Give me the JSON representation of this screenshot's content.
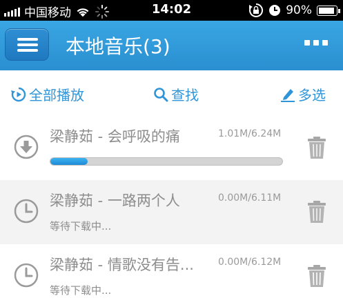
{
  "status_bar": {
    "carrier": "中国移动",
    "time": "14:02",
    "battery_percent": "90%",
    "battery_level": 0.9,
    "icons": [
      "signal-icon",
      "wifi-icon",
      "loading-icon",
      "rotation-lock-icon",
      "alarm-icon",
      "battery-icon"
    ]
  },
  "header": {
    "title": "本地音乐(3)",
    "menu_icon": "menu-icon",
    "more_icon": "more-icon"
  },
  "toolbar": {
    "play_all": "全部播放",
    "search": "查找",
    "multi_select": "多选"
  },
  "songs": [
    {
      "title": "梁静茹 - 会呼吸的痛",
      "size": "1.01M/6.24M",
      "state": "downloading",
      "progress": 0.16,
      "icon": "download-icon"
    },
    {
      "title": "梁静茹 - 一路两个人",
      "size": "0.00M/6.11M",
      "state": "waiting",
      "status": "等待下载中...",
      "icon": "clock-icon"
    },
    {
      "title": "梁静茹 - 情歌没有告...",
      "size": "0.00M/6.12M",
      "state": "waiting",
      "status": "等待下载中...",
      "icon": "clock-icon"
    }
  ],
  "colors": {
    "accent": "#2f95d8",
    "header_bg": "#3aa6e4",
    "text_muted": "#8d8d8d"
  }
}
